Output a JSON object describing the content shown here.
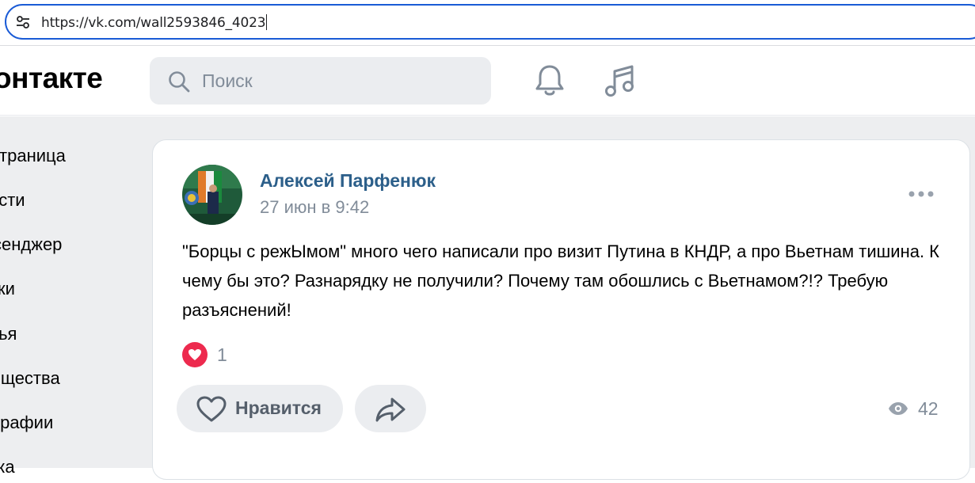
{
  "browser": {
    "url": "https://vk.com/wall2593846_4023",
    "site_info_icon": "tune-icon"
  },
  "header": {
    "logo_text": "онтакте",
    "search_placeholder": "Поиск",
    "icons": [
      "search-icon",
      "bell-icon",
      "music-icon"
    ]
  },
  "sidebar": {
    "items": [
      {
        "label": "я страница"
      },
      {
        "label": "ости"
      },
      {
        "label": "ссенджер"
      },
      {
        "label": "ки"
      },
      {
        "label": "зья"
      },
      {
        "label": "общества"
      },
      {
        "label": "тографии"
      },
      {
        "label": "ика"
      }
    ]
  },
  "post": {
    "author": "Алексей Парфенюк",
    "date": "27 июн в 9:42",
    "text": "\"Борцы с режЫмом\" много чего написали про визит Путина в КНДР, а про Вьетнам тишина. К чему бы это? Разнарядку не получили? Почему там обошлись с Вьетнамом?!? Требую разъяснений!",
    "reaction_count": "1",
    "like_label": "Нравится",
    "views_count": "42"
  },
  "colors": {
    "accent": "#2c5f8a",
    "url_border": "#1a5bd6",
    "reaction_red": "#ed2a4e",
    "muted": "#818c99",
    "button_bg": "#ebedf0",
    "page_bg": "#edeef0"
  }
}
